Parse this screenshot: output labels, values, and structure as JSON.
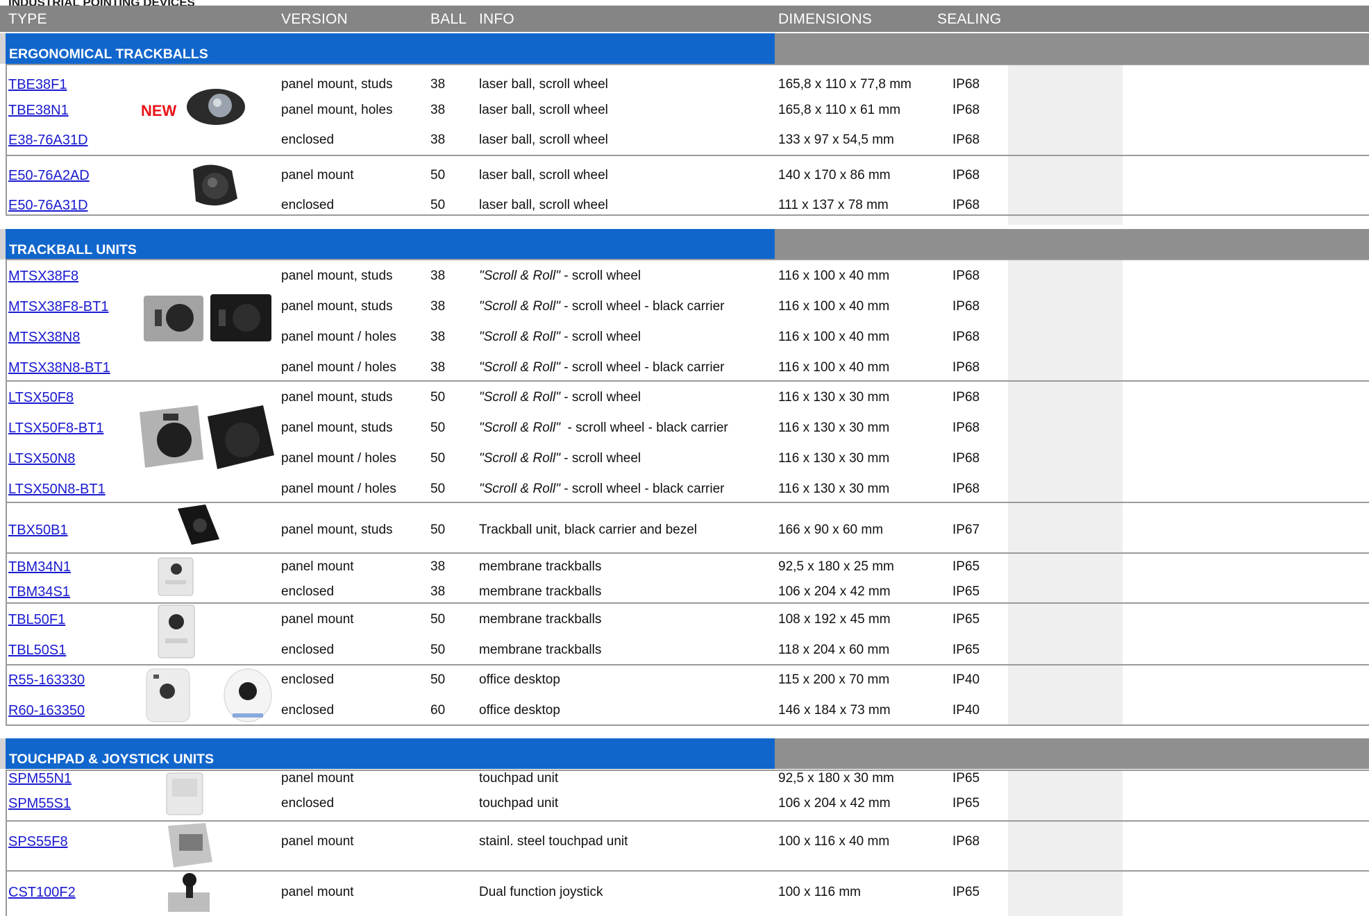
{
  "page": {
    "top_title": "INDUSTRIAL POINTING DEVICES"
  },
  "header": {
    "type": "TYPE",
    "version": "VERSION",
    "ball": "BALL",
    "info": "INFO",
    "dimensions": "DIMENSIONS",
    "sealing": "SEALING"
  },
  "sections": [
    {
      "title": "ERGONOMICAL TRACKBALLS"
    },
    {
      "title": "TRACKBALL UNITS"
    },
    {
      "title": "TOUCHPAD & JOYSTICK UNITS"
    }
  ],
  "badge_new": "NEW",
  "rows": [
    {
      "type": "TBE38F1",
      "version": "panel mount, studs",
      "ball": "38",
      "info": "laser ball, scroll wheel",
      "dim": "165,8 x 110 x 77,8 mm",
      "seal": "IP68"
    },
    {
      "type": "TBE38N1",
      "version": "panel mount, holes",
      "ball": "38",
      "info": "laser ball, scroll wheel",
      "dim": "165,8 x 110 x 61 mm",
      "seal": "IP68"
    },
    {
      "type": "E38-76A31D",
      "version": "enclosed",
      "ball": "38",
      "info": "laser ball, scroll wheel",
      "dim": "133 x 97 x 54,5 mm",
      "seal": "IP68"
    },
    {
      "type": "E50-76A2AD",
      "version": "panel mount",
      "ball": "50",
      "info": "laser ball, scroll wheel",
      "dim": "140 x 170 x 86 mm",
      "seal": "IP68"
    },
    {
      "type": "E50-76A31D",
      "version": "enclosed",
      "ball": "50",
      "info": "laser ball, scroll wheel",
      "dim": "111 x 137 x 78 mm",
      "seal": "IP68"
    },
    {
      "type": "MTSX38F8",
      "version": "panel mount, studs",
      "ball": "38",
      "info_i": "\"Scroll & Roll\"",
      "info": " - scroll wheel",
      "dim": "116 x 100 x 40 mm",
      "seal": "IP68"
    },
    {
      "type": "MTSX38F8-BT1",
      "version": "panel mount, studs",
      "ball": "38",
      "info_i": "\"Scroll & Roll\"",
      "info": " - scroll wheel - black carrier",
      "dim": "116 x 100 x 40 mm",
      "seal": "IP68"
    },
    {
      "type": "MTSX38N8",
      "version": "panel mount / holes",
      "ball": "38",
      "info_i": "\"Scroll & Roll\"",
      "info": " - scroll wheel",
      "dim": "116 x 100 x 40 mm",
      "seal": "IP68"
    },
    {
      "type": "MTSX38N8-BT1",
      "version": "panel mount / holes",
      "ball": "38",
      "info_i": "\"Scroll & Roll\"",
      "info": " - scroll wheel - black carrier",
      "dim": "116 x 100 x 40 mm",
      "seal": "IP68"
    },
    {
      "type": "LTSX50F8",
      "version": "panel mount, studs",
      "ball": "50",
      "info_i": "\"Scroll & Roll\"",
      "info": " - scroll wheel",
      "dim": "116 x 130 x 30 mm",
      "seal": "IP68"
    },
    {
      "type": "LTSX50F8-BT1",
      "version": "panel mount, studs",
      "ball": "50",
      "info_i": "\"Scroll & Roll\"",
      "info": "  - scroll wheel - black carrier",
      "dim": "116 x 130 x 30 mm",
      "seal": "IP68"
    },
    {
      "type": "LTSX50N8",
      "version": "panel mount / holes",
      "ball": "50",
      "info_i": "\"Scroll & Roll\"",
      "info": " - scroll wheel",
      "dim": "116 x 130 x 30 mm",
      "seal": "IP68"
    },
    {
      "type": "LTSX50N8-BT1",
      "version": "panel mount / holes",
      "ball": "50",
      "info_i": "\"Scroll & Roll\"",
      "info": " - scroll wheel - black carrier",
      "dim": "116 x 130 x 30 mm",
      "seal": "IP68"
    },
    {
      "type": "TBX50B1",
      "version": "panel mount, studs",
      "ball": "50",
      "info": "Trackball unit, black carrier and bezel",
      "dim": "166 x 90 x 60 mm",
      "seal": "IP67"
    },
    {
      "type": "TBM34N1",
      "version": "panel mount",
      "ball": "38",
      "info": "membrane trackballs",
      "dim": "92,5 x 180 x 25 mm",
      "seal": "IP65"
    },
    {
      "type": "TBM34S1",
      "version": "enclosed",
      "ball": "38",
      "info": "membrane trackballs",
      "dim": "106 x 204 x 42 mm",
      "seal": "IP65"
    },
    {
      "type": "TBL50F1",
      "version": "panel mount",
      "ball": "50",
      "info": "membrane trackballs",
      "dim": "108 x 192 x 45 mm",
      "seal": "IP65"
    },
    {
      "type": "TBL50S1",
      "version": "enclosed",
      "ball": "50",
      "info": "membrane trackballs",
      "dim": "118 x 204 x 60 mm",
      "seal": "IP65"
    },
    {
      "type": "R55-163330",
      "version": "enclosed",
      "ball": "50",
      "info": "office desktop",
      "dim": "115 x 200 x 70 mm",
      "seal": "IP40"
    },
    {
      "type": "R60-163350",
      "version": "enclosed",
      "ball": "60",
      "info": "office desktop",
      "dim": "146 x 184 x 73 mm",
      "seal": "IP40"
    },
    {
      "type": "SPM55N1",
      "version": "panel mount",
      "ball": "",
      "info": "touchpad unit",
      "dim": "92,5 x 180 x 30 mm",
      "seal": "IP65"
    },
    {
      "type": "SPM55S1",
      "version": "enclosed",
      "ball": "",
      "info": "touchpad unit",
      "dim": "106 x 204 x 42 mm",
      "seal": "IP65"
    },
    {
      "type": "SPS55F8",
      "version": "panel mount",
      "ball": "",
      "info": "stainl. steel touchpad unit",
      "dim": "100 x 116 x 40 mm",
      "seal": "IP68"
    },
    {
      "type": "CST100F2",
      "version": "panel mount",
      "ball": "",
      "info": "Dual function joystick",
      "dim": "100 x 116 mm",
      "seal": "IP65"
    }
  ]
}
